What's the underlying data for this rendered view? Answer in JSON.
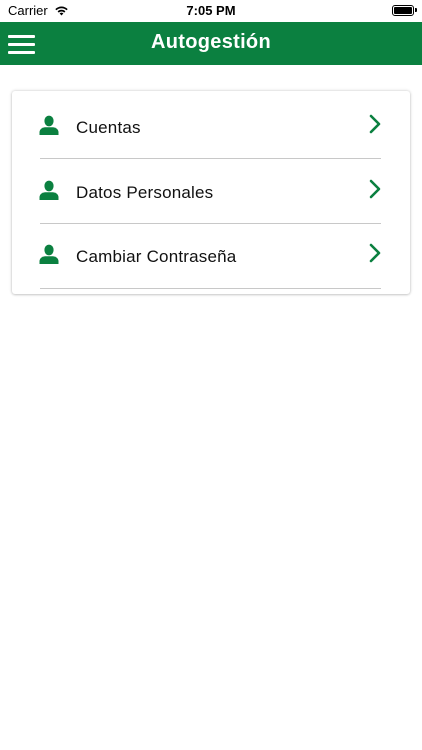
{
  "status_bar": {
    "carrier": "Carrier",
    "time": "7:05 PM"
  },
  "navbar": {
    "title": "Autogestión",
    "menu_icon": "hamburger-menu-icon",
    "background_color": "#0b8040"
  },
  "menu": {
    "items": [
      {
        "label": "Cuentas",
        "icon": "user-icon",
        "trailing_icon": "chevron-right-icon"
      },
      {
        "label": "Datos Personales",
        "icon": "user-icon",
        "trailing_icon": "chevron-right-icon"
      },
      {
        "label": "Cambiar Contraseña",
        "icon": "user-icon",
        "trailing_icon": "chevron-right-icon"
      }
    ]
  },
  "colors": {
    "accent": "#0b8040",
    "divider": "#c8c8c8",
    "text": "#111111"
  }
}
